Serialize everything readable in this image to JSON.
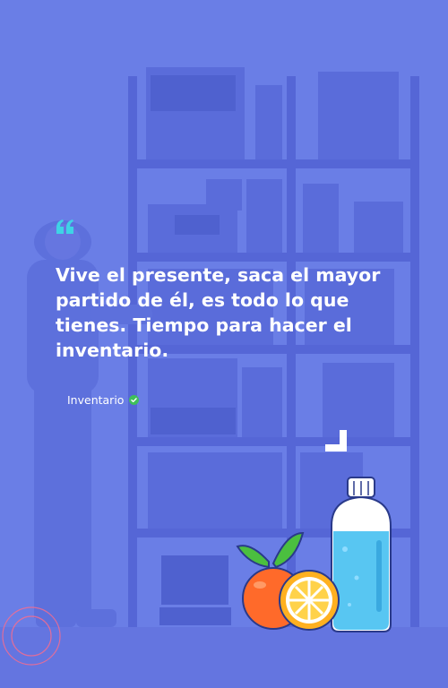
{
  "quote": {
    "text": "Vive el presente, saca el mayor partido de él, es todo lo que tienes. Tiempo para hacer el inventario."
  },
  "author": {
    "name": "Inventario",
    "verified_icon": "check-circle-icon"
  },
  "icons": {
    "quote_mark": "quote-icon",
    "corner": "corner-bracket-icon"
  },
  "colors": {
    "background": "#6a7ee6",
    "quote_mark": "#3fd3e6",
    "verified": "#3fbf5a",
    "text": "#ffffff"
  }
}
